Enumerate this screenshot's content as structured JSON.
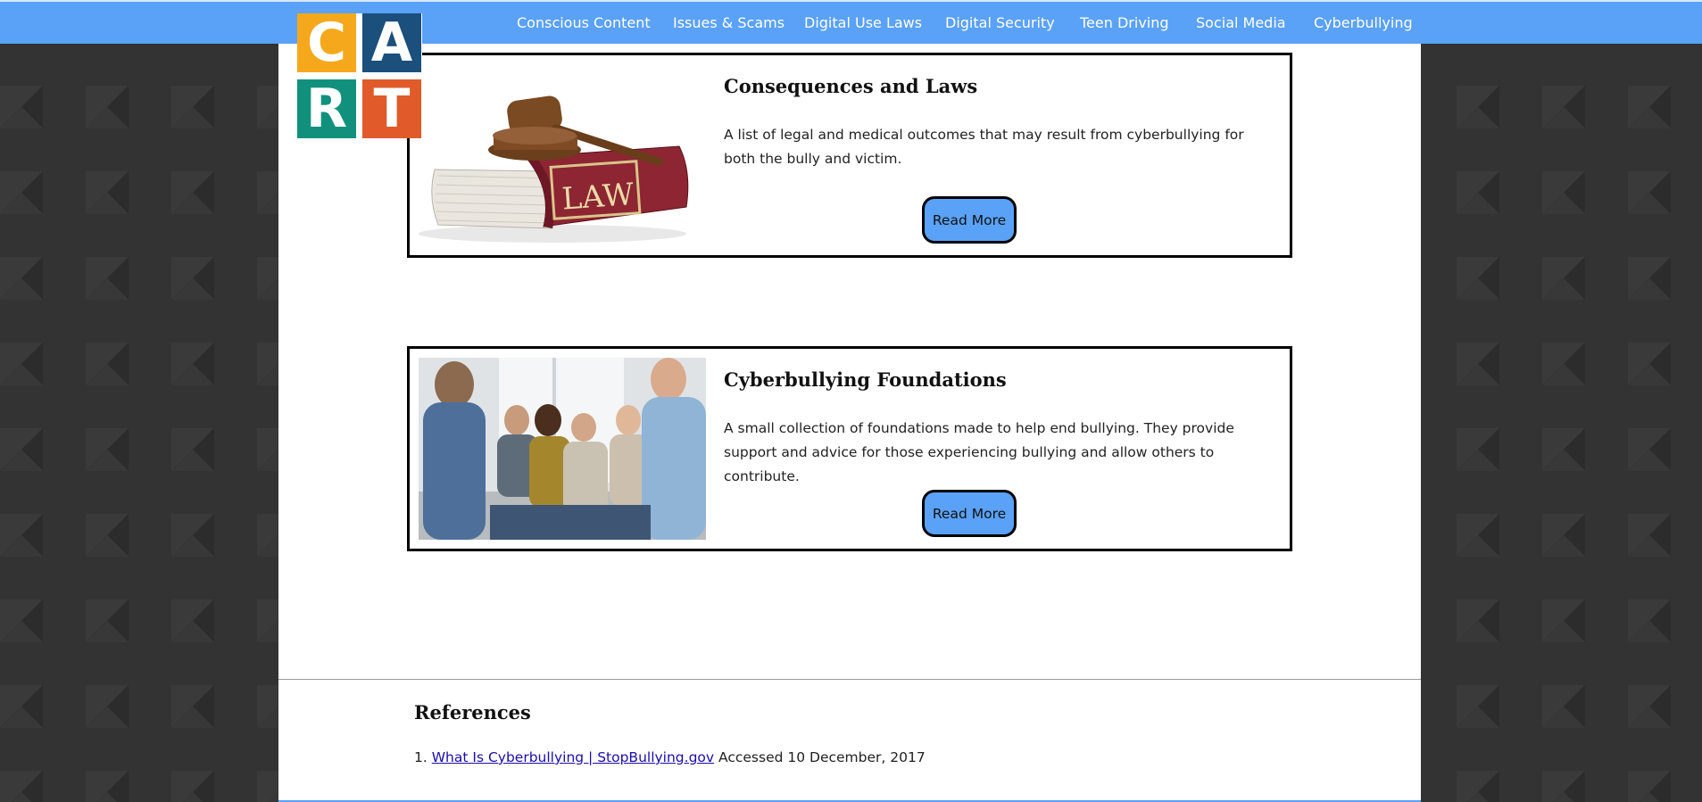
{
  "colors": {
    "nav_bar": "#5aa1f8",
    "button": "#5aa1f8",
    "logo_c": "#f6a81c",
    "logo_a": "#1b4f7c",
    "logo_r": "#11917d",
    "logo_t": "#e05a2a"
  },
  "logo": {
    "letters": [
      "C",
      "A",
      "R",
      "T"
    ]
  },
  "nav": {
    "items": [
      {
        "label": "Conscious Content"
      },
      {
        "label": "Issues & Scams"
      },
      {
        "label": "Digital Use Laws"
      },
      {
        "label": "Digital Security"
      },
      {
        "label": "Teen Driving"
      },
      {
        "label": "Social Media"
      },
      {
        "label": "Cyberbullying"
      }
    ]
  },
  "cards": [
    {
      "title": "Consequences and Laws",
      "description": "A list of legal and medical outcomes that may result from cyberbullying for both the bully and victim.",
      "button": "Read More",
      "image": "law-book-gavel-image",
      "image_text": "LAW"
    },
    {
      "title": "Cyberbullying Foundations",
      "description": "A small collection of foundations made to help end bullying. They provide support and advice for those experiencing bullying and allow others to contribute.",
      "button": "Read More",
      "image": "support-group-photo"
    }
  ],
  "references": {
    "title": "References",
    "items": [
      {
        "number": "1.",
        "link_text": "What Is Cyberbullying | StopBullying.gov",
        "accessed": " Accessed 10 December, 2017"
      }
    ]
  }
}
